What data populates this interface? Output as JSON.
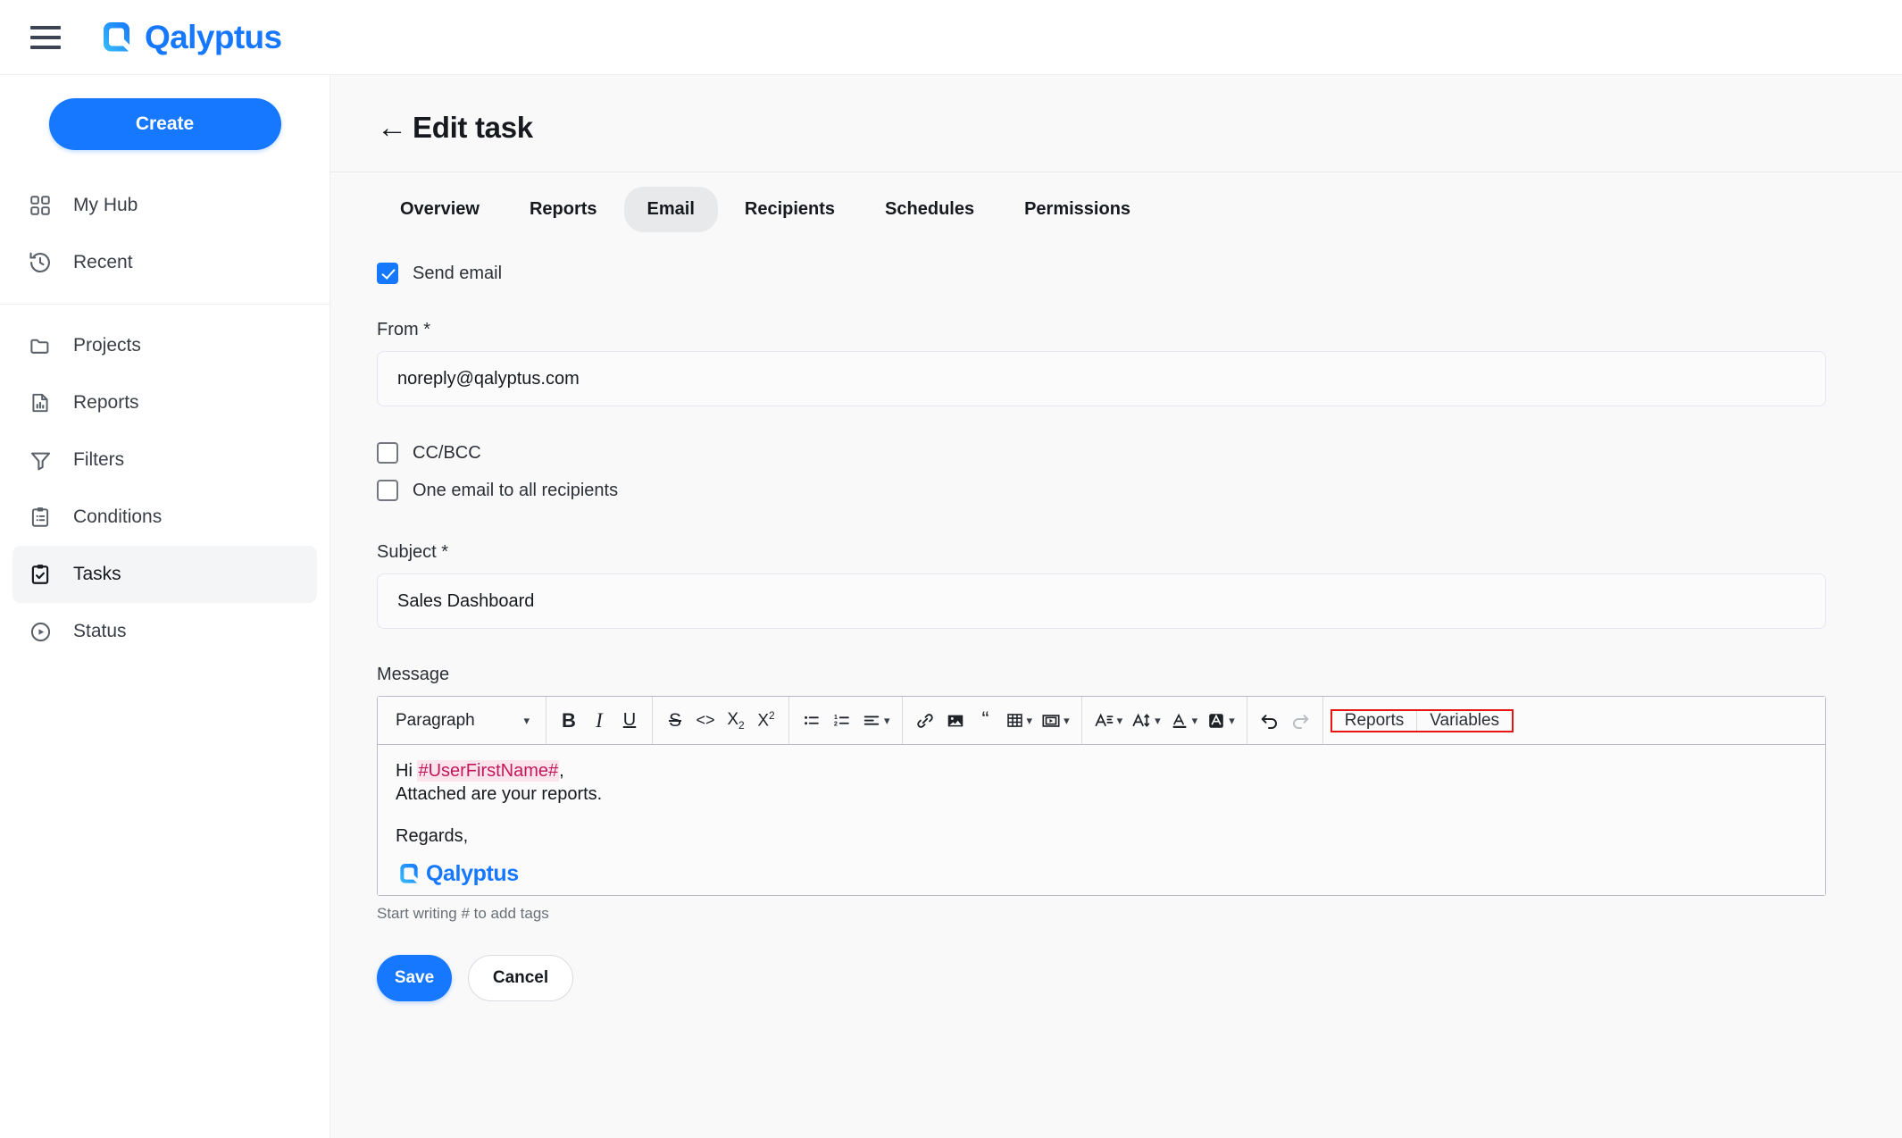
{
  "brand": {
    "name": "Qalyptus",
    "accent": "#1677ff"
  },
  "topbar": {
    "menu_icon": "hamburger-menu-icon"
  },
  "sidebar": {
    "create_label": "Create",
    "groups": [
      {
        "items": [
          {
            "label": "My Hub",
            "icon": "grid-icon",
            "active": false
          },
          {
            "label": "Recent",
            "icon": "history-clock-icon",
            "active": false
          }
        ]
      },
      {
        "items": [
          {
            "label": "Projects",
            "icon": "folder-icon",
            "active": false
          },
          {
            "label": "Reports",
            "icon": "document-chart-icon",
            "active": false
          },
          {
            "label": "Filters",
            "icon": "funnel-icon",
            "active": false
          },
          {
            "label": "Conditions",
            "icon": "clipboard-list-icon",
            "active": false
          },
          {
            "label": "Tasks",
            "icon": "clipboard-check-icon",
            "active": true
          },
          {
            "label": "Status",
            "icon": "play-circle-icon",
            "active": false
          }
        ]
      }
    ]
  },
  "page": {
    "back_icon": "back-arrow-icon",
    "title": "Edit task",
    "tabs": [
      {
        "label": "Overview",
        "active": false
      },
      {
        "label": "Reports",
        "active": false
      },
      {
        "label": "Email",
        "active": true
      },
      {
        "label": "Recipients",
        "active": false
      },
      {
        "label": "Schedules",
        "active": false
      },
      {
        "label": "Permissions",
        "active": false
      }
    ]
  },
  "form": {
    "send_email": {
      "label": "Send email",
      "checked": true
    },
    "from": {
      "label": "From *",
      "value": "noreply@qalyptus.com",
      "placeholder": ""
    },
    "ccbcc": {
      "label": "CC/BCC",
      "checked": false
    },
    "one_email": {
      "label": "One email to all recipients",
      "checked": false
    },
    "subject": {
      "label": "Subject *",
      "value": "Sales Dashboard",
      "placeholder": ""
    },
    "message": {
      "label": "Message",
      "hint": "Start writing # to add tags"
    }
  },
  "toolbar": {
    "paragraph_label": "Paragraph",
    "reports_label": "Reports",
    "variables_label": "Variables",
    "highlight_color": "#e8140f",
    "buttons": [
      "bold-icon",
      "italic-icon",
      "underline-icon",
      "strikethrough-icon",
      "code-icon",
      "subscript-icon",
      "superscript-icon",
      "bullet-list-icon",
      "numbered-list-icon",
      "align-icon",
      "link-icon",
      "image-icon",
      "blockquote-icon",
      "table-icon",
      "media-icon",
      "font-family-icon",
      "font-size-icon",
      "text-color-icon",
      "highlight-icon",
      "undo-icon",
      "redo-icon"
    ]
  },
  "editor": {
    "greeting_prefix": "Hi ",
    "tag": "#UserFirstName#",
    "greeting_suffix": ",",
    "line2": "Attached are your reports.",
    "line3": "Regards,",
    "signature": "Qalyptus"
  },
  "actions": {
    "save_label": "Save",
    "cancel_label": "Cancel"
  }
}
